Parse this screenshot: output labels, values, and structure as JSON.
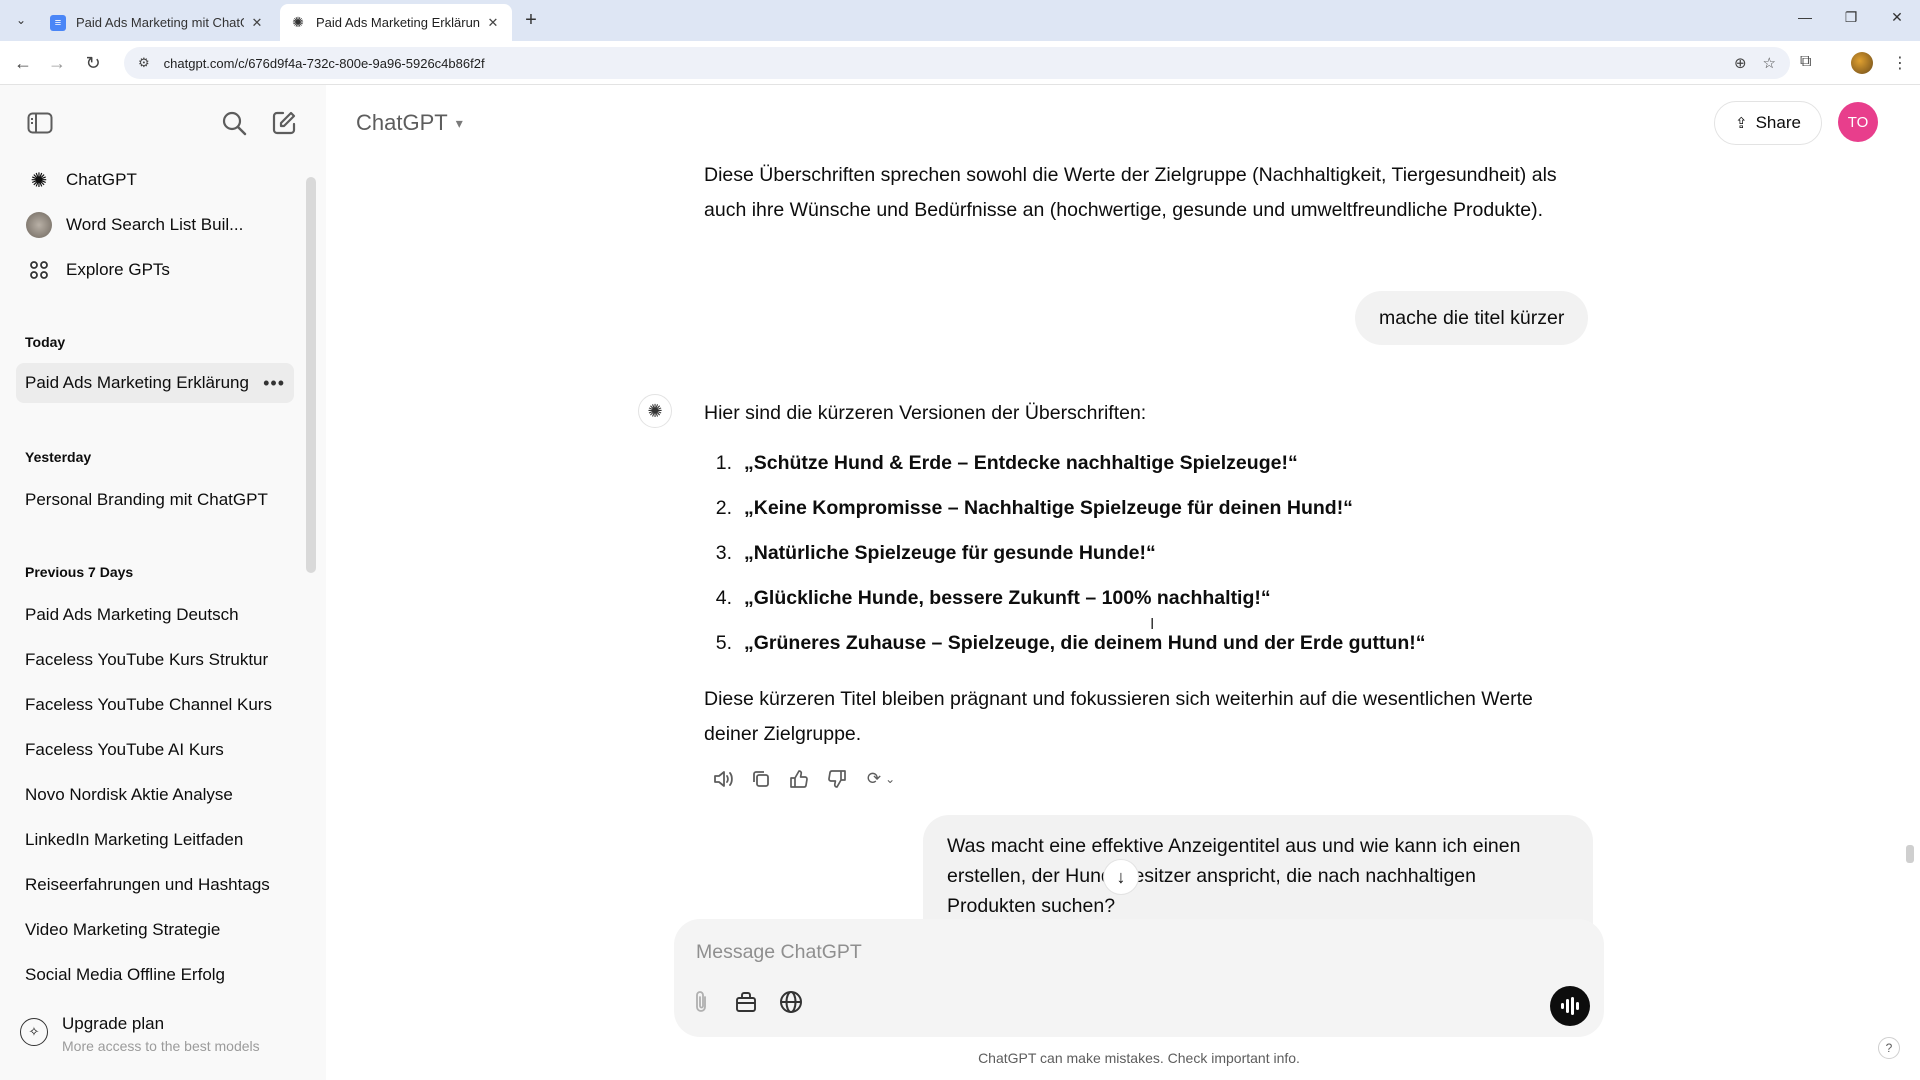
{
  "browser": {
    "tabs": [
      {
        "title": "Paid Ads Marketing mit ChatGPT",
        "active": false
      },
      {
        "title": "Paid Ads Marketing Erklärung",
        "active": true
      }
    ],
    "url": "chatgpt.com/c/676d9f4a-732c-800e-9a96-5926c4b86f2f"
  },
  "sidebar": {
    "top_items": [
      {
        "label": "ChatGPT",
        "icon": "openai-logo-icon"
      },
      {
        "label": "Word Search List Buil...",
        "icon": "gpt-avatar-icon"
      },
      {
        "label": "Explore GPTs",
        "icon": "grid-icon"
      }
    ],
    "sections": [
      {
        "title": "Today",
        "items": [
          "Paid Ads Marketing Erklärung"
        ]
      },
      {
        "title": "Yesterday",
        "items": [
          "Personal Branding mit ChatGPT"
        ]
      },
      {
        "title": "Previous 7 Days",
        "items": [
          "Paid Ads Marketing Deutsch",
          "Faceless YouTube Kurs Struktur",
          "Faceless YouTube Channel Kurs",
          "Faceless YouTube AI Kurs",
          "Novo Nordisk Aktie Analyse",
          "LinkedIn Marketing Leitfaden",
          "Reiseerfahrungen und Hashtags",
          "Video Marketing Strategie",
          "Social Media Offline Erfolg"
        ]
      }
    ],
    "selected_item": "Paid Ads Marketing Erklärung",
    "upgrade": {
      "title": "Upgrade plan",
      "subtitle": "More access to the best models"
    }
  },
  "header": {
    "model": "ChatGPT",
    "share_label": "Share",
    "avatar_initials": "TO"
  },
  "conversation": {
    "prev_answer_tail": "Diese Überschriften sprechen sowohl die Werte der Zielgruppe (Nachhaltigkeit, Tiergesundheit) als auch ihre Wünsche und Bedürfnisse an (hochwertige, gesunde und umweltfreundliche Produkte).",
    "user_message_1": "mache die titel kürzer",
    "answer_intro": "Hier sind die kürzeren Versionen der Überschriften:",
    "answer_items": [
      {
        "num": "1.",
        "text": "„Schütze Hund & Erde – Entdecke nachhaltige Spielzeuge!“"
      },
      {
        "num": "2.",
        "text": "„Keine Kompromisse – Nachhaltige Spielzeuge für deinen Hund!“"
      },
      {
        "num": "3.",
        "text": "„Natürliche Spielzeuge für gesunde Hunde!“"
      },
      {
        "num": "4.",
        "text": "„Glückliche Hunde, bessere Zukunft – 100% nachhaltig!“"
      },
      {
        "num": "5.",
        "text": "„Grüneres Zuhause – Spielzeuge, die deinem Hund und der Erde guttun!“"
      }
    ],
    "answer_outro": "Diese kürzeren Titel bleiben prägnant und fokussieren sich weiterhin auf die wesentlichen Werte deiner Zielgruppe.",
    "user_message_2": "Was macht eine effektive Anzeigentitel aus und wie kann ich einen erstellen, der Hundebesitzer anspricht, die nach nachhaltigen Produkten suchen?"
  },
  "composer": {
    "placeholder": "Message ChatGPT"
  },
  "footer": {
    "disclaimer": "ChatGPT can make mistakes. Check important info.",
    "help": "?"
  },
  "colors": {
    "sidebar_bg": "#f9f9f9",
    "avatar_bg": "#e83e8c",
    "bubble_bg": "#f2f2f2",
    "tabstrip_bg": "#dee6f4"
  }
}
